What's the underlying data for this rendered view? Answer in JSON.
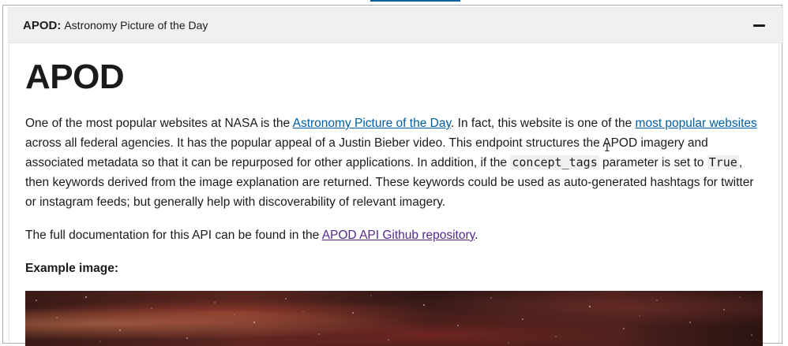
{
  "accordion": {
    "title_bold": "APOD:",
    "title_rest": "Astronomy Picture of the Day",
    "collapse_icon": "minus-icon"
  },
  "section": {
    "heading": "APOD",
    "p1": {
      "t1": "One of the most popular websites at NASA is the ",
      "link1": "Astronomy Picture of the Day",
      "t2": ". In fact, this website is one of the ",
      "link2": "most popular websites",
      "t3": " across all federal agencies. It has the popular appeal of a Justin Bieber video. This endpoint structures the APOD imagery and associated metadata so that it can be repurposed for other applications. In addition, if the ",
      "code1": "concept_tags",
      "t4": " parameter is set to ",
      "code2": "True",
      "t5": ", then keywords derived from the image explanation are returned. These keywords could be used as auto-generated hashtags for twitter or instagram feeds; but generally help with discoverability of relevant imagery."
    },
    "p2": {
      "t1": "The full documentation for this API can be found in the ",
      "link": "APOD API Github repository",
      "t2": "."
    },
    "example_label": "Example image:"
  },
  "colors": {
    "link": "#005ea2",
    "visited_link": "#54278f",
    "header_bg": "#f0f0f0",
    "text": "#1b1b1b"
  }
}
